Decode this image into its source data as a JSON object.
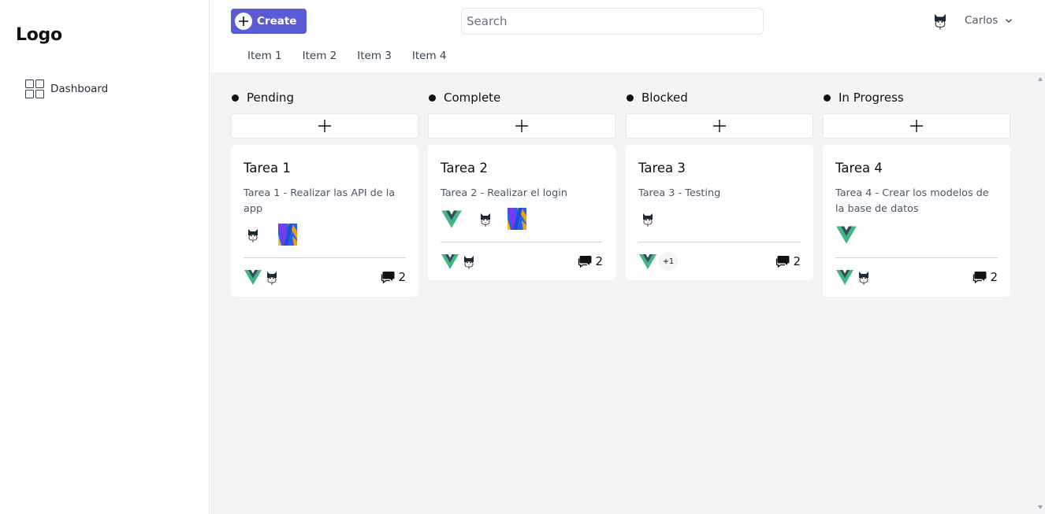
{
  "sidebar": {
    "logo": "Logo",
    "items": [
      {
        "label": "Dashboard",
        "icon": "grid-icon"
      }
    ]
  },
  "header": {
    "create_label": "Create",
    "search_placeholder": "Search",
    "user_name": "Carlos",
    "tabs": [
      "Item 1",
      "Item 2",
      "Item 3",
      "Item 4"
    ]
  },
  "colors": {
    "accent": "#5b5bd6",
    "board_bg": "#f3f4f6",
    "vue_green": "#41b883",
    "vue_dark": "#35495e"
  },
  "columns": [
    {
      "name": "Pending",
      "card": {
        "title": "Tarea 1",
        "description": "Tarea 1 - Realizar las API de la app",
        "comments": "2"
      }
    },
    {
      "name": "Complete",
      "card": {
        "title": "Tarea 2",
        "description": "Tarea 2 - Realizar el login",
        "comments": "2"
      }
    },
    {
      "name": "Blocked",
      "card": {
        "title": "Tarea 3",
        "description": "Tarea 3 - Testing",
        "comments": "2",
        "extra_members": "+1"
      }
    },
    {
      "name": "In Progress",
      "card": {
        "title": "Tarea 4",
        "description": "Tarea 4 - Crear los modelos de la base de datos",
        "comments": "2"
      }
    }
  ]
}
